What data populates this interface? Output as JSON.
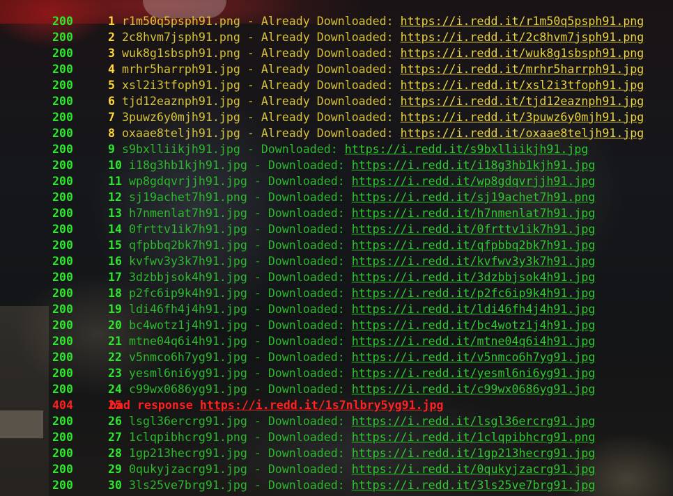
{
  "terminal": {
    "lines": [
      {
        "status": "200",
        "num": "1",
        "file": "r1m50q5psph91.png",
        "message": " - Already Downloaded: ",
        "url": "https://i.redd.it/r1m50q5psph91.png",
        "kind": "already"
      },
      {
        "status": "200",
        "num": "2",
        "file": "2c8hvm7jsph91.png",
        "message": " - Already Downloaded: ",
        "url": "https://i.redd.it/2c8hvm7jsph91.png",
        "kind": "already"
      },
      {
        "status": "200",
        "num": "3",
        "file": "wuk8g1sbsph91.png",
        "message": " - Already Downloaded: ",
        "url": "https://i.redd.it/wuk8g1sbsph91.png",
        "kind": "already"
      },
      {
        "status": "200",
        "num": "4",
        "file": "mrhr5harrph91.jpg",
        "message": " - Already Downloaded: ",
        "url": "https://i.redd.it/mrhr5harrph91.jpg",
        "kind": "already"
      },
      {
        "status": "200",
        "num": "5",
        "file": "xsl2i3tfoph91.jpg",
        "message": " - Already Downloaded: ",
        "url": "https://i.redd.it/xsl2i3tfoph91.jpg",
        "kind": "already"
      },
      {
        "status": "200",
        "num": "6",
        "file": "tjd12eaznph91.jpg",
        "message": " - Already Downloaded: ",
        "url": "https://i.redd.it/tjd12eaznph91.jpg",
        "kind": "already"
      },
      {
        "status": "200",
        "num": "7",
        "file": "3puwz6y0mjh91.jpg",
        "message": " - Already Downloaded: ",
        "url": "https://i.redd.it/3puwz6y0mjh91.jpg",
        "kind": "already"
      },
      {
        "status": "200",
        "num": "8",
        "file": "oxaae8teljh91.jpg",
        "message": " - Already Downloaded: ",
        "url": "https://i.redd.it/oxaae8teljh91.jpg",
        "kind": "already"
      },
      {
        "status": "200",
        "num": "9",
        "file": "s9bxlliikjh91.jpg",
        "message": " - Downloaded: ",
        "url": "https://i.redd.it/s9bxlliikjh91.jpg",
        "kind": "ok"
      },
      {
        "status": "200",
        "num": "10",
        "file": "i18g3hb1kjh91.jpg",
        "message": " - Downloaded: ",
        "url": "https://i.redd.it/i18g3hb1kjh91.jpg",
        "kind": "ok"
      },
      {
        "status": "200",
        "num": "11",
        "file": "wp8gdqvrjjh91.jpg",
        "message": " - Downloaded: ",
        "url": "https://i.redd.it/wp8gdqvrjjh91.jpg",
        "kind": "ok"
      },
      {
        "status": "200",
        "num": "12",
        "file": "sj19achet7h91.png",
        "message": " - Downloaded: ",
        "url": "https://i.redd.it/sj19achet7h91.png",
        "kind": "ok"
      },
      {
        "status": "200",
        "num": "13",
        "file": "h7nmenlat7h91.jpg",
        "message": " - Downloaded: ",
        "url": "https://i.redd.it/h7nmenlat7h91.jpg",
        "kind": "ok"
      },
      {
        "status": "200",
        "num": "14",
        "file": "0frttv1ik7h91.jpg",
        "message": " - Downloaded: ",
        "url": "https://i.redd.it/0frttv1ik7h91.jpg",
        "kind": "ok"
      },
      {
        "status": "200",
        "num": "15",
        "file": "qfpbbq2bk7h91.jpg",
        "message": " - Downloaded: ",
        "url": "https://i.redd.it/qfpbbq2bk7h91.jpg",
        "kind": "ok"
      },
      {
        "status": "200",
        "num": "16",
        "file": "kvfwv3y3k7h91.jpg",
        "message": " - Downloaded: ",
        "url": "https://i.redd.it/kvfwv3y3k7h91.jpg",
        "kind": "ok"
      },
      {
        "status": "200",
        "num": "17",
        "file": "3dzbbjsok4h91.jpg",
        "message": " - Downloaded: ",
        "url": "https://i.redd.it/3dzbbjsok4h91.jpg",
        "kind": "ok"
      },
      {
        "status": "200",
        "num": "18",
        "file": "p2fc6ip9k4h91.jpg",
        "message": " - Downloaded: ",
        "url": "https://i.redd.it/p2fc6ip9k4h91.jpg",
        "kind": "ok"
      },
      {
        "status": "200",
        "num": "19",
        "file": "ldi46fh4j4h91.jpg",
        "message": " - Downloaded: ",
        "url": "https://i.redd.it/ldi46fh4j4h91.jpg",
        "kind": "ok"
      },
      {
        "status": "200",
        "num": "20",
        "file": "bc4wotz1j4h91.jpg",
        "message": " - Downloaded: ",
        "url": "https://i.redd.it/bc4wotz1j4h91.jpg",
        "kind": "ok"
      },
      {
        "status": "200",
        "num": "21",
        "file": "mtne04q6i4h91.jpg",
        "message": " - Downloaded: ",
        "url": "https://i.redd.it/mtne04q6i4h91.jpg",
        "kind": "ok"
      },
      {
        "status": "200",
        "num": "22",
        "file": "v5nmco6h7yg91.jpg",
        "message": " - Downloaded: ",
        "url": "https://i.redd.it/v5nmco6h7yg91.jpg",
        "kind": "ok"
      },
      {
        "status": "200",
        "num": "23",
        "file": "yesml6ni6yg91.jpg",
        "message": " - Downloaded: ",
        "url": "https://i.redd.it/yesml6ni6yg91.jpg",
        "kind": "ok"
      },
      {
        "status": "200",
        "num": "24",
        "file": "c99wx0686yg91.jpg",
        "message": " - Downloaded: ",
        "url": "https://i.redd.it/c99wx0686yg91.jpg",
        "kind": "ok"
      },
      {
        "status": "404",
        "num": "25",
        "file": "",
        "message": "bad response ",
        "url": "https://i.redd.it/1s7nlbry5yg91.jpg",
        "kind": "bad"
      },
      {
        "status": "200",
        "num": "26",
        "file": "lsgl36ercrg91.jpg",
        "message": " - Downloaded: ",
        "url": "https://i.redd.it/lsgl36ercrg91.jpg",
        "kind": "ok"
      },
      {
        "status": "200",
        "num": "27",
        "file": "1clqpibhcrg91.png",
        "message": " - Downloaded: ",
        "url": "https://i.redd.it/1clqpibhcrg91.png",
        "kind": "ok"
      },
      {
        "status": "200",
        "num": "28",
        "file": "1gp213hecrg91.jpg",
        "message": " - Downloaded: ",
        "url": "https://i.redd.it/1gp213hecrg91.jpg",
        "kind": "ok"
      },
      {
        "status": "200",
        "num": "29",
        "file": "0qukyjzacrg91.jpg",
        "message": " - Downloaded: ",
        "url": "https://i.redd.it/0qukyjzacrg91.jpg",
        "kind": "ok"
      },
      {
        "status": "200",
        "num": "30",
        "file": "3ls25ve7brg91.jpg",
        "message": " - Downloaded: ",
        "url": "https://i.redd.it/3ls25ve7brg91.jpg",
        "kind": "ok"
      }
    ]
  },
  "colors": {
    "ok_green": "#2ee62e",
    "already_yellow": "#d8c73a",
    "bad_red": "#ff2020"
  }
}
